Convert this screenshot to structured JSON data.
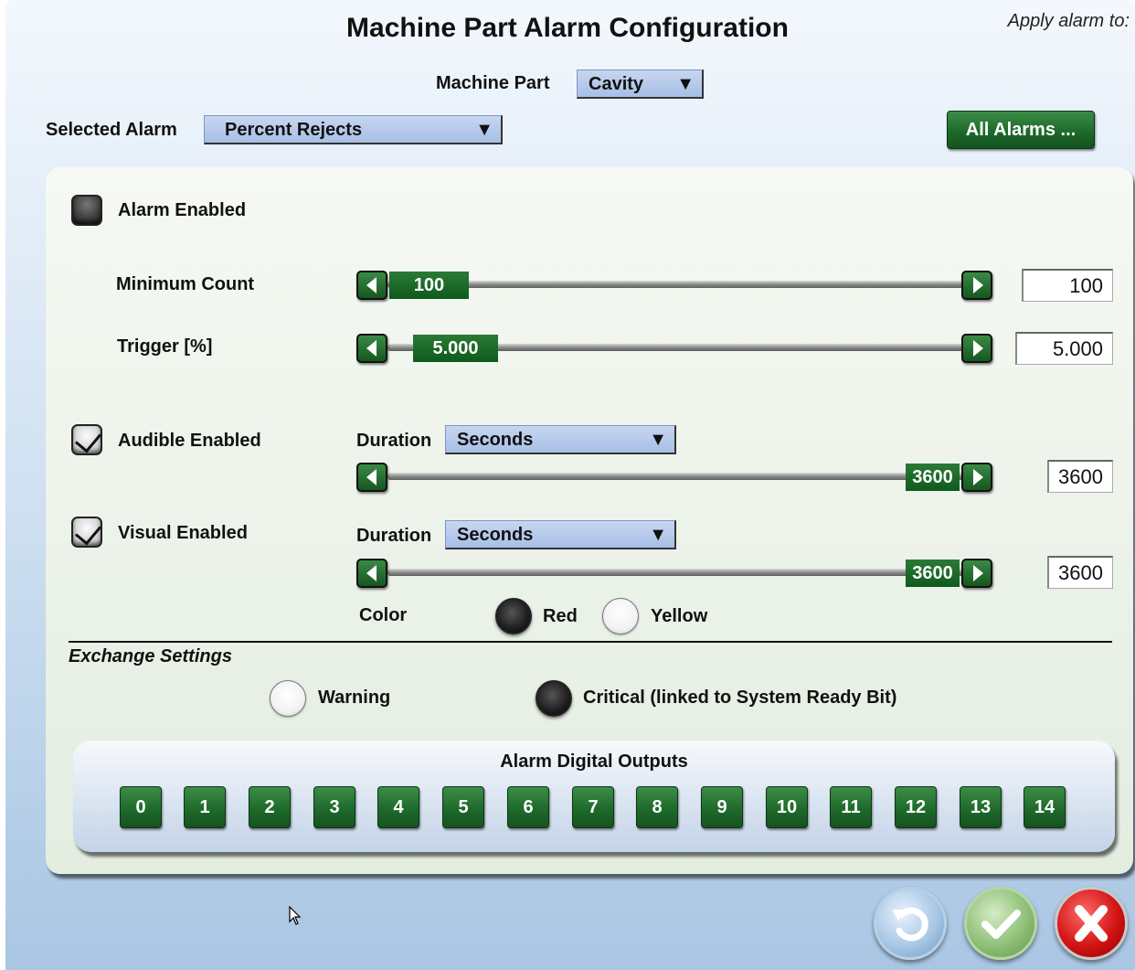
{
  "window": {
    "title": "Machine Part Alarm Configuration",
    "apply_label": "Apply alarm to:"
  },
  "machine_part": {
    "label": "Machine Part",
    "value": "Cavity"
  },
  "selected_alarm": {
    "label": "Selected Alarm",
    "value": "Percent Rejects"
  },
  "all_alarms_button": "All Alarms ...",
  "alarm_enabled": {
    "label": "Alarm Enabled",
    "checked": false
  },
  "minimum_count": {
    "label": "Minimum Count",
    "value": "100",
    "thumb": "100"
  },
  "trigger": {
    "label": "Trigger [%]",
    "value": "5.000",
    "thumb": "5.000"
  },
  "audible": {
    "label": "Audible Enabled",
    "checked": true,
    "duration_label": "Duration",
    "duration_unit": "Seconds",
    "value": "3600",
    "thumb": "3600"
  },
  "visual": {
    "label": "Visual Enabled",
    "checked": true,
    "duration_label": "Duration",
    "duration_unit": "Seconds",
    "value": "3600",
    "thumb": "3600"
  },
  "color": {
    "label": "Color",
    "options": [
      {
        "label": "Red",
        "selected": true
      },
      {
        "label": "Yellow",
        "selected": false
      }
    ]
  },
  "exchange": {
    "title": "Exchange Settings",
    "options": [
      {
        "label": "Warning",
        "selected": false
      },
      {
        "label": "Critical (linked to System Ready Bit)",
        "selected": true
      }
    ]
  },
  "digital_outputs": {
    "title": "Alarm Digital Outputs",
    "buttons": [
      "0",
      "1",
      "2",
      "3",
      "4",
      "5",
      "6",
      "7",
      "8",
      "9",
      "10",
      "11",
      "12",
      "13",
      "14"
    ]
  },
  "footer": {
    "icons": [
      "undo-icon",
      "checkmark-icon",
      "close-icon"
    ]
  },
  "colors": {
    "accent_green": "#1e6a2b",
    "combo_blue": "#a7bfe6",
    "cancel_red": "#d21414"
  }
}
